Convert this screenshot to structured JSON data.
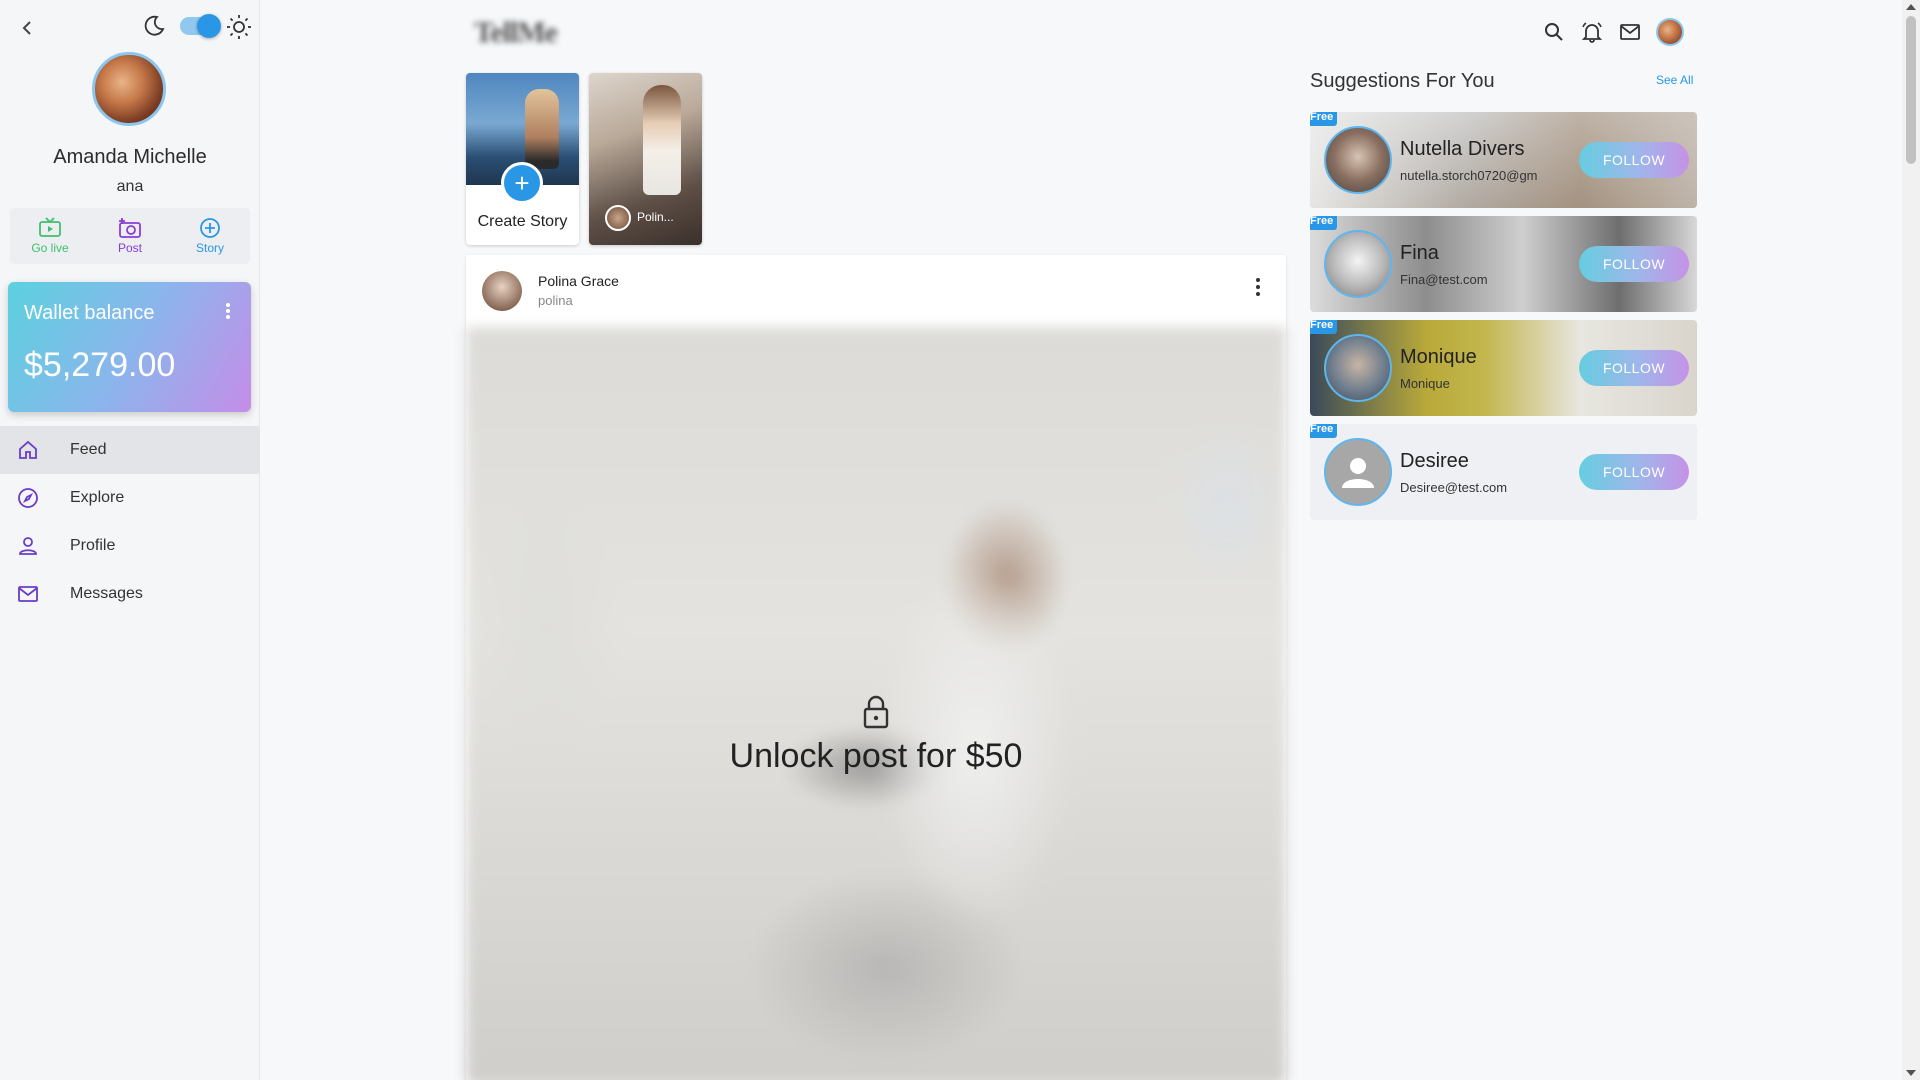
{
  "sidebar": {
    "back_icon": "chevron-left-icon",
    "theme_toggle": {
      "moon_icon": "moon-icon",
      "sun_icon": "sun-icon",
      "checked": true
    },
    "profile": {
      "name": "Amanda Michelle",
      "username": "ana"
    },
    "actions": [
      {
        "label": "Go live",
        "icon": "tv-icon",
        "color": "#3fbf6f"
      },
      {
        "label": "Post",
        "icon": "camera-plus-icon",
        "color": "#8a3cd6"
      },
      {
        "label": "Story",
        "icon": "plus-circle-icon",
        "color": "#2a96e6"
      }
    ],
    "wallet": {
      "title": "Wallet balance",
      "amount": "$5,279.00"
    },
    "nav": [
      {
        "label": "Feed",
        "icon": "home-icon",
        "active": true
      },
      {
        "label": "Explore",
        "icon": "compass-icon",
        "active": false
      },
      {
        "label": "Profile",
        "icon": "person-icon",
        "active": false
      },
      {
        "label": "Messages",
        "icon": "mail-icon",
        "active": false
      }
    ]
  },
  "header": {
    "logo_text": "TellMe",
    "icons": [
      "search-icon",
      "bell-icon",
      "mail-icon",
      "avatar"
    ]
  },
  "stories": {
    "create_label": "Create Story",
    "items": [
      {
        "name": "Polin..."
      }
    ]
  },
  "post": {
    "author_name": "Polina Grace",
    "author_username": "polina",
    "unlock_text": "Unlock post for $50"
  },
  "suggestions": {
    "title": "Suggestions For You",
    "see_all": "See All",
    "items": [
      {
        "badge": "Free",
        "name": "Nutella Divers",
        "email": "nutella.storch0720@gm",
        "follow_label": "FOLLOW"
      },
      {
        "badge": "Free",
        "name": "Fina",
        "email": "Fina@test.com",
        "follow_label": "FOLLOW"
      },
      {
        "badge": "Free",
        "name": "Monique",
        "email": "Monique",
        "follow_label": "FOLLOW"
      },
      {
        "badge": "Free",
        "name": "Desiree",
        "email": "Desiree@test.com",
        "follow_label": "FOLLOW"
      }
    ]
  },
  "colors": {
    "accent": "#2a96e6",
    "purple": "#8a3cd6",
    "green": "#3fbf6f"
  }
}
